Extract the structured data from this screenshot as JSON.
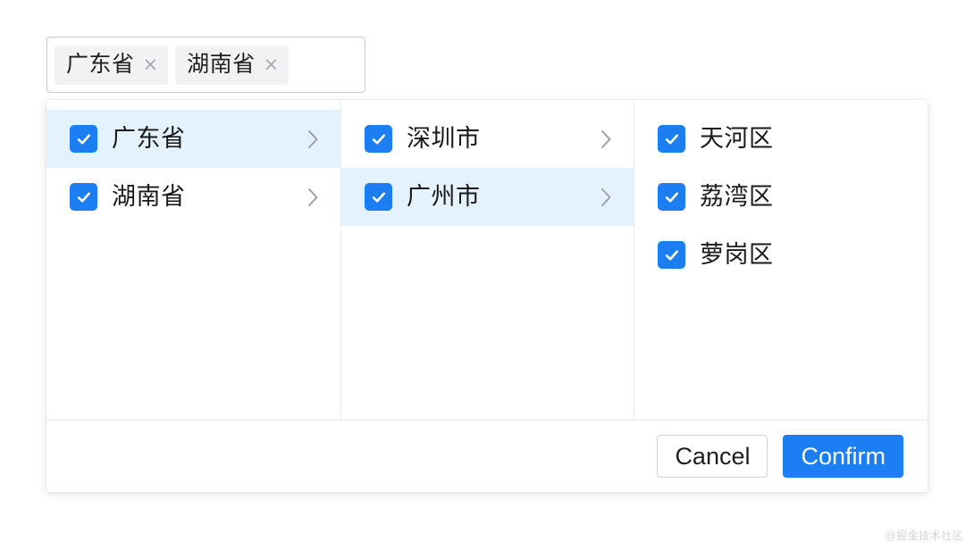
{
  "tag_input": {
    "name": "selected-regions-input",
    "tags": [
      {
        "label": "广东省",
        "close_icon": "close-x-icon",
        "close_glyph": "×"
      },
      {
        "label": "湖南省",
        "close_icon": "close-x-icon",
        "close_glyph": "×"
      }
    ]
  },
  "cascader": {
    "columns": [
      {
        "name": "province-column",
        "options": [
          {
            "label": "广东省",
            "checked": true,
            "active": true,
            "has_children": true,
            "arrow_icon": "chevron-right-icon"
          },
          {
            "label": "湖南省",
            "checked": true,
            "active": false,
            "has_children": true,
            "arrow_icon": "chevron-right-icon"
          }
        ]
      },
      {
        "name": "city-column",
        "options": [
          {
            "label": "深圳市",
            "checked": true,
            "active": false,
            "has_children": true,
            "arrow_icon": "chevron-right-icon"
          },
          {
            "label": "广州市",
            "checked": true,
            "active": true,
            "has_children": true,
            "arrow_icon": "chevron-right-icon"
          }
        ]
      },
      {
        "name": "district-column",
        "options": [
          {
            "label": "天河区",
            "checked": true,
            "active": false,
            "has_children": false
          },
          {
            "label": "荔湾区",
            "checked": true,
            "active": false,
            "has_children": false
          },
          {
            "label": "萝岗区",
            "checked": true,
            "active": false,
            "has_children": false
          }
        ]
      }
    ]
  },
  "footer": {
    "cancel_label": "Cancel",
    "confirm_label": "Confirm"
  },
  "watermark": {
    "text": "@掘金技术社区"
  },
  "colors": {
    "accent": "#1c7ef3",
    "active_row": "#e4f2fd",
    "tag_background": "#f1f2f3",
    "divider": "#ebecee",
    "text": "#1a1a1a",
    "muted": "#9b9ea3"
  }
}
